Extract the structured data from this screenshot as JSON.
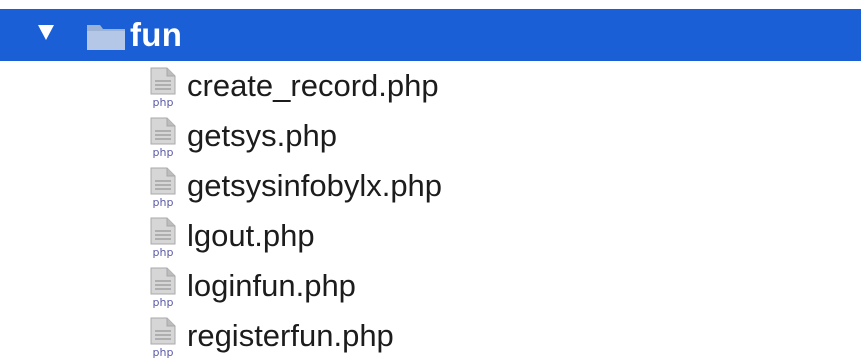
{
  "folder": {
    "name": "fun",
    "expanded": true,
    "selection_color": "#1a5fd6",
    "icon": "folder-icon",
    "disclosure_icon": "triangle-down-icon"
  },
  "files": [
    {
      "name": "create_record.php",
      "icon": "php-file-icon",
      "badge": "php"
    },
    {
      "name": "getsys.php",
      "icon": "php-file-icon",
      "badge": "php"
    },
    {
      "name": "getsysinfobylx.php",
      "icon": "php-file-icon",
      "badge": "php"
    },
    {
      "name": "lgout.php",
      "icon": "php-file-icon",
      "badge": "php"
    },
    {
      "name": "loginfun.php",
      "icon": "php-file-icon",
      "badge": "php"
    },
    {
      "name": "registerfun.php",
      "icon": "php-file-icon",
      "badge": "php"
    }
  ]
}
